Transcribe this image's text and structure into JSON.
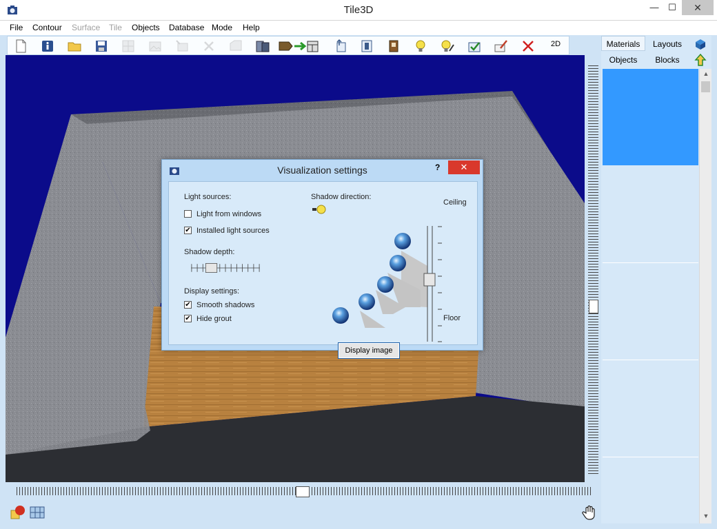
{
  "window": {
    "title": "Tile3D",
    "minimize": "—",
    "maximize": "☐",
    "close": "✕"
  },
  "menu": [
    {
      "label": "File",
      "enabled": true
    },
    {
      "label": "Contour",
      "enabled": true
    },
    {
      "label": "Surface",
      "enabled": false
    },
    {
      "label": "Tile",
      "enabled": false
    },
    {
      "label": "Objects",
      "enabled": true
    },
    {
      "label": "Database",
      "enabled": true
    },
    {
      "label": "Mode",
      "enabled": true
    },
    {
      "label": "Help",
      "enabled": true
    }
  ],
  "toolbar": {
    "mode_2d": "2D",
    "buttons": [
      "new-icon",
      "info-icon",
      "open-folder-icon",
      "save-icon",
      "grid-icon",
      "image-icon",
      "image-add-icon",
      "delete-icon",
      "shape-icon",
      "door-icon",
      "move-icon",
      "export-icon",
      "import-icon",
      "panel-icon",
      "light-bulb-icon",
      "light-edit-icon",
      "check-icon",
      "edit-icon",
      "close-icon"
    ]
  },
  "right_panel": {
    "tabs": [
      {
        "label": "Materials",
        "active": true
      },
      {
        "label": "Layouts",
        "active": false
      },
      {
        "label": "Objects",
        "active": false
      },
      {
        "label": "Blocks",
        "active": false
      }
    ],
    "side_icons": [
      "cube-icon",
      "arrow-up-icon"
    ],
    "scroll_up": "▲",
    "scroll_down": "▼"
  },
  "dialog": {
    "title": "Visualization settings",
    "help": "?",
    "close": "✕",
    "light_sources_label": "Light sources:",
    "light_from_windows": {
      "label": "Light from windows",
      "checked": false
    },
    "installed_light_sources": {
      "label": "Installed light sources",
      "checked": true
    },
    "shadow_depth_label": "Shadow depth:",
    "shadow_depth_value": 0.3,
    "display_settings_label": "Display settings:",
    "smooth_shadows": {
      "label": "Smooth shadows",
      "checked": true
    },
    "hide_grout": {
      "label": "Hide grout",
      "checked": true
    },
    "shadow_direction_label": "Shadow direction:",
    "ceiling_label": "Ceiling",
    "floor_label": "Floor",
    "shadow_direction_value": 0.5,
    "display_image_button": "Display image",
    "check_mark": "✔"
  },
  "colors": {
    "viewport_sky": "#0b0b8a",
    "wall": "#8a8c92",
    "floor_wood": "#b07a3a",
    "selection": "#3399ff",
    "close_red": "#d9382c"
  }
}
